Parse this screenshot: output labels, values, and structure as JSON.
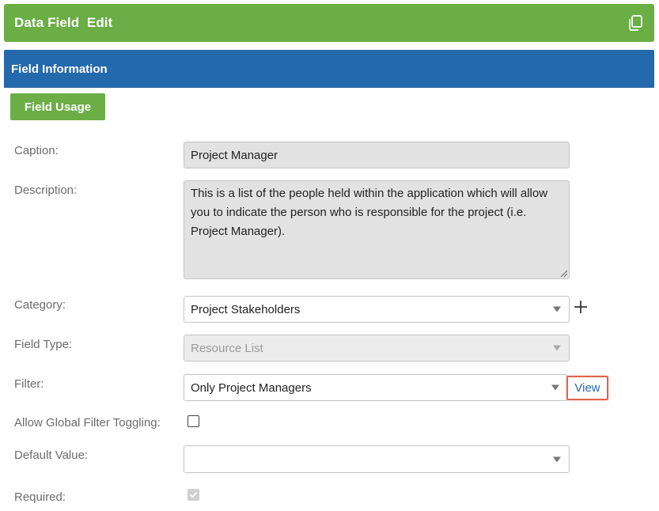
{
  "header": {
    "title": "Data Field  Edit",
    "copy_icon": "copy-icon",
    "color": "#6aae45"
  },
  "section": {
    "title": "Field Information",
    "color": "#2469ab"
  },
  "buttons": {
    "field_usage": "Field Usage"
  },
  "form": {
    "caption": {
      "label": "Caption:",
      "value": "Project Manager"
    },
    "description": {
      "label": "Description:",
      "value": "This is a list of the people held within the application which will allow you to indicate the person who is responsible for the project (i.e. Project Manager)."
    },
    "category": {
      "label": "Category:",
      "value": "Project Stakeholders",
      "add_icon": "plus-icon"
    },
    "field_type": {
      "label": "Field Type:",
      "value": "Resource List",
      "disabled": true
    },
    "filter": {
      "label": "Filter:",
      "value": "Only Project Managers",
      "link": "View"
    },
    "global_filter": {
      "label": "Allow Global Filter Toggling:",
      "checked": false
    },
    "default_value": {
      "label": "Default Value:",
      "value": ""
    },
    "required": {
      "label": "Required:",
      "checked": true,
      "disabled": true
    }
  },
  "highlight_color": "#e0644e"
}
